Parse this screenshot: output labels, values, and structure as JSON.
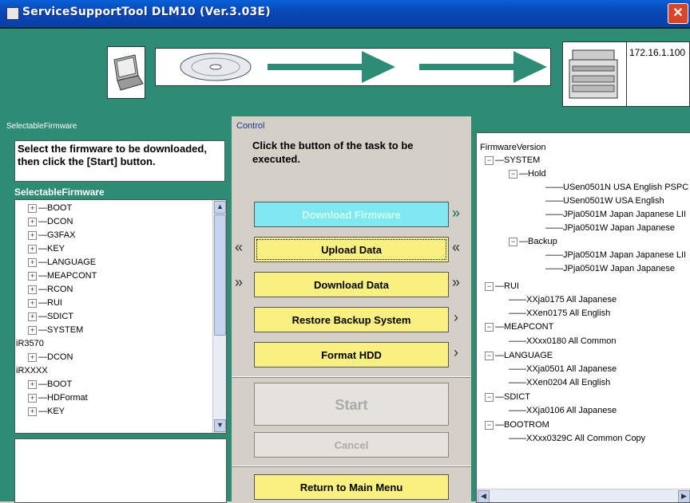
{
  "window": {
    "title": "ServiceSupportTool DLM10 (Ver.3.03E)",
    "close": "✕"
  },
  "banner": {
    "ip": "172.16.1.100"
  },
  "left": {
    "group_label": "SelectableFirmware",
    "instruction": "Select the firmware to be downloaded, then click the [Start] button.",
    "list_title": "SelectableFirmware",
    "tree": [
      {
        "label": "BOOT",
        "kind": "child"
      },
      {
        "label": "DCON",
        "kind": "child"
      },
      {
        "label": "G3FAX",
        "kind": "child"
      },
      {
        "label": "KEY",
        "kind": "child"
      },
      {
        "label": "LANGUAGE",
        "kind": "child"
      },
      {
        "label": "MEAPCONT",
        "kind": "child"
      },
      {
        "label": "RCON",
        "kind": "child"
      },
      {
        "label": "RUI",
        "kind": "child"
      },
      {
        "label": "SDICT",
        "kind": "child"
      },
      {
        "label": "SYSTEM",
        "kind": "child"
      },
      {
        "label": "iR3570",
        "kind": "root"
      },
      {
        "label": "DCON",
        "kind": "child"
      },
      {
        "label": "iRXXXX",
        "kind": "root"
      },
      {
        "label": "BOOT",
        "kind": "child"
      },
      {
        "label": "HDFormat",
        "kind": "child"
      },
      {
        "label": "KEY",
        "kind": "child"
      }
    ]
  },
  "control": {
    "label": "Control",
    "instruction": "Click the button of the task to be executed.",
    "download_firmware": "Download Firmware",
    "upload_data": "Upload Data",
    "download_data": "Download Data",
    "restore_backup": "Restore Backup System",
    "format_hdd": "Format HDD",
    "start": "Start",
    "cancel": "Cancel",
    "return_main": "Return to Main Menu"
  },
  "firmware_version": {
    "title": "FirmwareVersion",
    "items": [
      {
        "label": "SYSTEM"
      },
      {
        "label": "Hold"
      },
      {
        "label": "USen0501N USA English PSPC"
      },
      {
        "label": "USen0501W USA English"
      },
      {
        "label": "JPja0501M Japan Japanese LII"
      },
      {
        "label": "JPja0501W Japan Japanese"
      },
      {
        "label": "Backup"
      },
      {
        "label": "JPja0501M Japan Japanese LII"
      },
      {
        "label": "JPja0501W Japan Japanese"
      },
      {
        "label": "RUI"
      },
      {
        "label": "XXja0175 All Japanese"
      },
      {
        "label": "XXen0175 All English"
      },
      {
        "label": "MEAPCONT"
      },
      {
        "label": "XXxx0180 All Common"
      },
      {
        "label": "LANGUAGE"
      },
      {
        "label": "XXja0501 All Japanese"
      },
      {
        "label": "XXen0204 All English"
      },
      {
        "label": "SDICT"
      },
      {
        "label": "XXja0106 All Japanese"
      },
      {
        "label": "BOOTROM"
      },
      {
        "label": "XXxx0329C All Common Copy"
      }
    ]
  }
}
